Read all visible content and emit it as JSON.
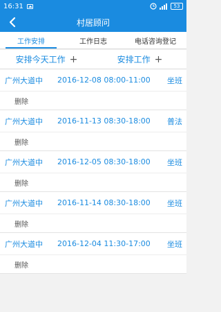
{
  "status_bar": {
    "time": "16:31",
    "battery": "53"
  },
  "header": {
    "title": "村居顾问"
  },
  "tabs": [
    {
      "label": "工作安排",
      "active": true
    },
    {
      "label": "工作日志",
      "active": false
    },
    {
      "label": "电话咨询登记",
      "active": false
    }
  ],
  "actions": {
    "today": "安排今天工作",
    "arrange": "安排工作",
    "plus": "+"
  },
  "entries": [
    {
      "address": "广州大道中",
      "time": "2016-12-08 08:00-11:00",
      "kind": "坐班",
      "delete": "删除"
    },
    {
      "address": "广州大道中",
      "time": "2016-11-13 08:30-18:00",
      "kind": "普法",
      "delete": "删除"
    },
    {
      "address": "广州大道中",
      "time": "2016-12-05 08:30-18:00",
      "kind": "坐班",
      "delete": "删除"
    },
    {
      "address": "广州大道中",
      "time": "2016-11-14 08:30-18:00",
      "kind": "坐班",
      "delete": "删除"
    },
    {
      "address": "广州大道中",
      "time": "2016-12-04 11:30-17:00",
      "kind": "坐班",
      "delete": "删除"
    }
  ],
  "colors": {
    "primary": "#1a8be0",
    "background": "#f2f2f2"
  }
}
